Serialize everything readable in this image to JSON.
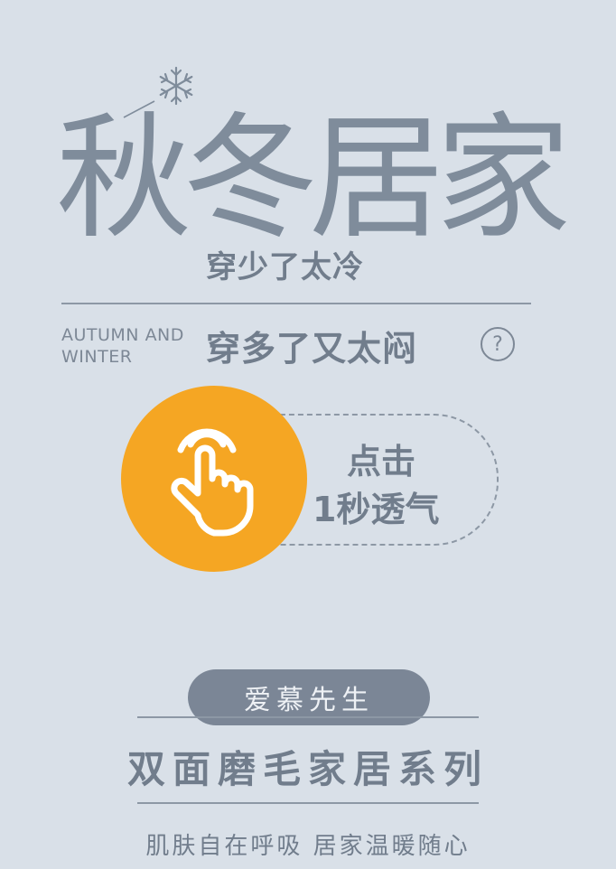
{
  "title": {
    "main": "秋冬居家",
    "sub_line1": "穿少了太冷",
    "sub_line2": "穿多了又太闷",
    "question_mark": "?",
    "english_line1": "AUTUMN AND",
    "english_line2": "WINTER"
  },
  "action": {
    "line1": "点击",
    "line2": "1秒透气",
    "icon": "hand-pointer-icon"
  },
  "brand": {
    "name": "爱慕先生"
  },
  "product": {
    "series": "双面磨毛家居系列",
    "tagline": "肌肤自在呼吸  居家温暖随心"
  },
  "colors": {
    "background": "#d9e0e8",
    "text": "#717d8c",
    "accent": "#f5a623",
    "badge": "#7b8696"
  }
}
